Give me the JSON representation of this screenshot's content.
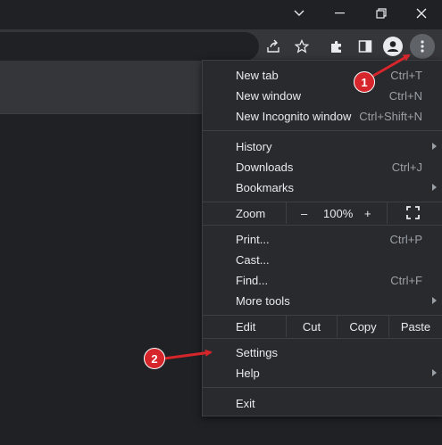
{
  "menu": {
    "new_tab": {
      "label": "New tab",
      "shortcut": "Ctrl+T"
    },
    "new_window": {
      "label": "New window",
      "shortcut": "Ctrl+N"
    },
    "new_incognito": {
      "label": "New Incognito window",
      "shortcut": "Ctrl+Shift+N"
    },
    "history": {
      "label": "History"
    },
    "downloads": {
      "label": "Downloads",
      "shortcut": "Ctrl+J"
    },
    "bookmarks": {
      "label": "Bookmarks"
    },
    "zoom": {
      "label": "Zoom",
      "minus": "–",
      "level": "100%",
      "plus": "+"
    },
    "print": {
      "label": "Print...",
      "shortcut": "Ctrl+P"
    },
    "cast": {
      "label": "Cast..."
    },
    "find": {
      "label": "Find...",
      "shortcut": "Ctrl+F"
    },
    "more_tools": {
      "label": "More tools"
    },
    "edit": {
      "label": "Edit",
      "cut": "Cut",
      "copy": "Copy",
      "paste": "Paste"
    },
    "settings": {
      "label": "Settings"
    },
    "help": {
      "label": "Help"
    },
    "exit": {
      "label": "Exit"
    }
  },
  "annotations": {
    "badge1": "1",
    "badge2": "2",
    "accent": "#d7262b"
  },
  "icons": [
    "chevron-down-icon",
    "minimize-icon",
    "restore-icon",
    "close-icon",
    "share-icon",
    "star-icon",
    "extensions-icon",
    "side-panel-icon",
    "profile-icon",
    "kebab-menu-icon",
    "fullscreen-icon"
  ]
}
